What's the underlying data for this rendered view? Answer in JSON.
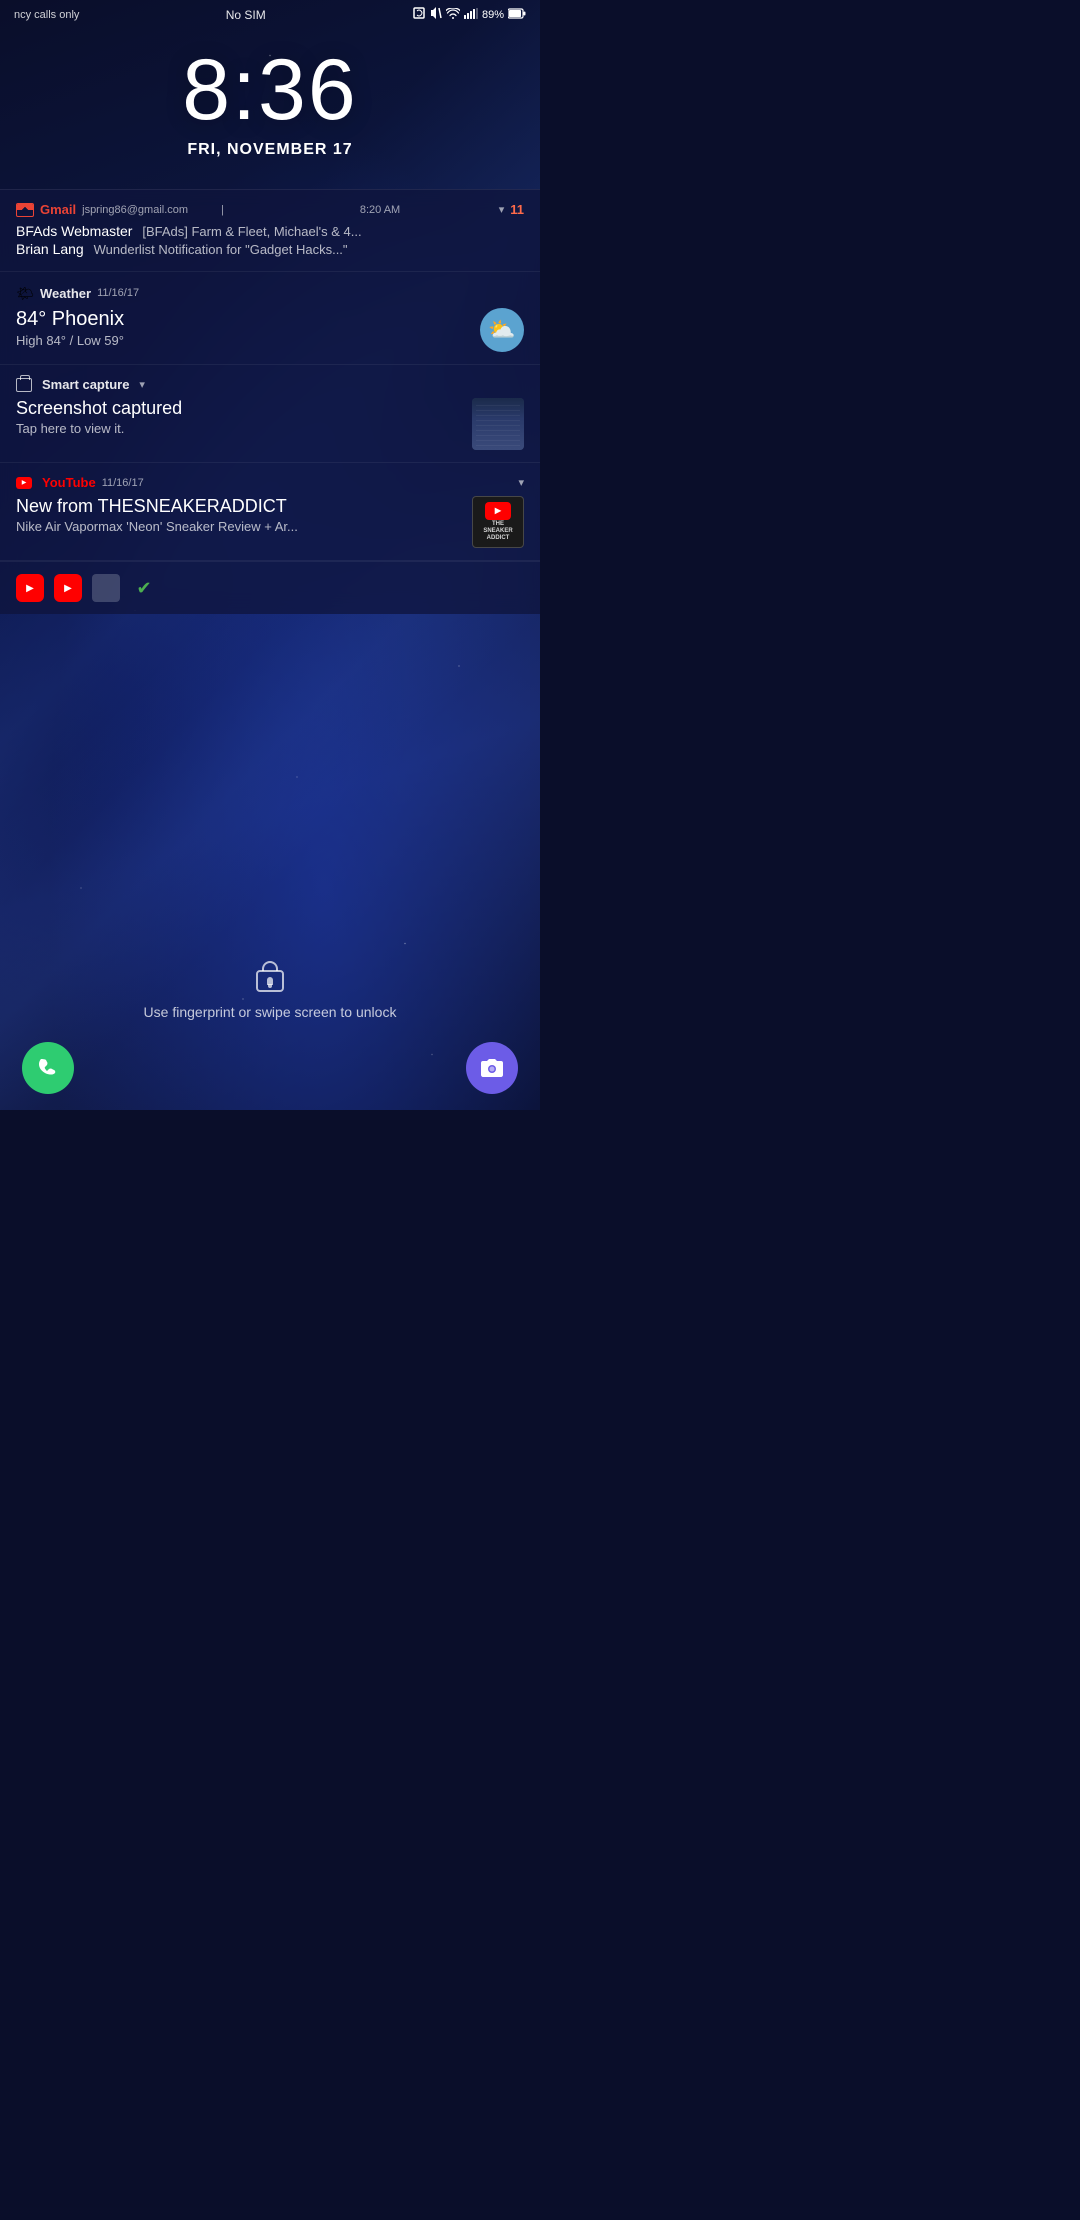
{
  "status_bar": {
    "left": "ncy calls only",
    "center": "No SIM",
    "battery": "89%",
    "icons": [
      "nfc",
      "mute",
      "wifi",
      "signal",
      "battery"
    ]
  },
  "clock": {
    "time": "8:36",
    "date": "FRI, NOVEMBER 17"
  },
  "notifications": {
    "gmail": {
      "app_name": "Gmail",
      "email": "jspring86@gmail.com",
      "time": "8:20 AM",
      "badge": "11",
      "messages": [
        {
          "sender": "BFAds Webmaster",
          "subject": "[BFAds] Farm & Fleet, Michael's & 4..."
        },
        {
          "sender": "Brian Lang",
          "subject": "Wunderlist Notification for \"Gadget Hacks...\""
        }
      ]
    },
    "weather": {
      "app_name": "Weather",
      "date": "11/16/17",
      "temperature": "84° Phoenix",
      "range": "High 84° / Low 59°",
      "icon": "⛅"
    },
    "smart_capture": {
      "app_name": "Smart capture",
      "title": "Screenshot captured",
      "subtitle": "Tap here to view it."
    },
    "youtube": {
      "app_name": "YouTube",
      "date": "11/16/17",
      "title": "New from THESNEAKERADDICT",
      "subtitle": "Nike Air Vapormax 'Neon' Sneaker Review + Ar..."
    }
  },
  "app_tray_icons": [
    "youtube",
    "youtube",
    "grid",
    "check"
  ],
  "lock_text": "Use fingerprint or swipe screen to unlock",
  "dock": {
    "phone_icon": "📞",
    "camera_icon": "📷"
  }
}
